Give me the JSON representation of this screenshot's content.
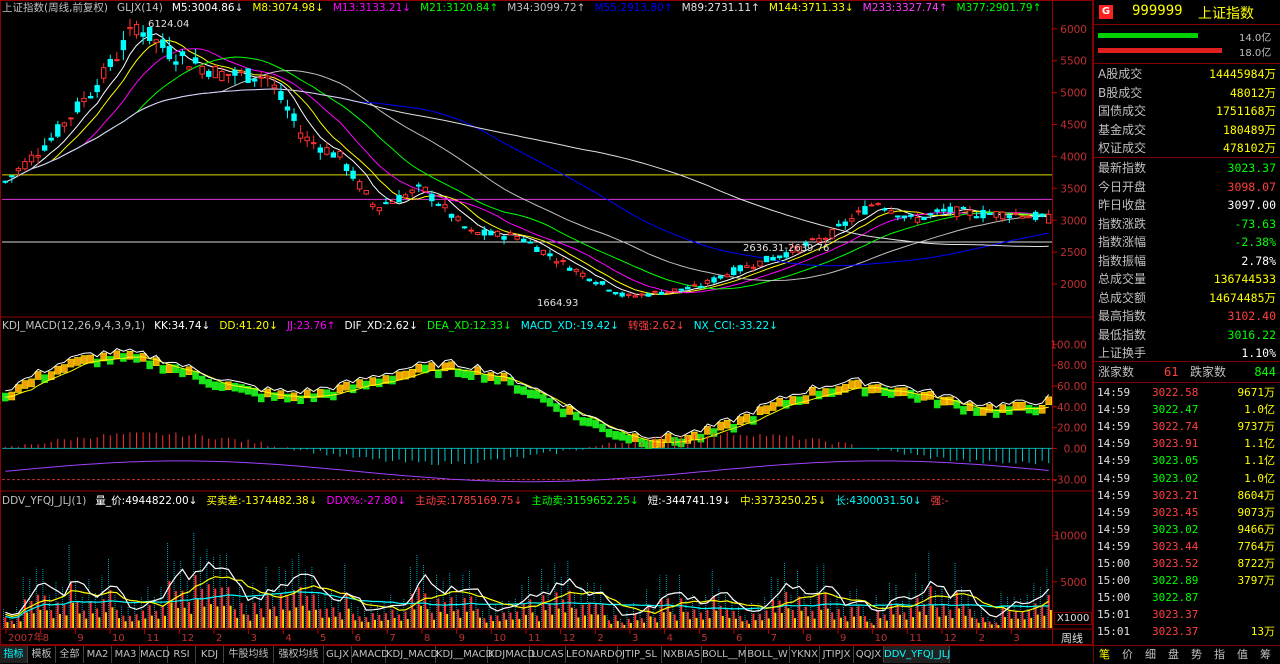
{
  "main_header": [
    {
      "text": "上证指数(周线,前复权)",
      "color": "#c0c0c0"
    },
    {
      "text": "GLJX(14)",
      "color": "#c0c0c0"
    },
    {
      "text": "M5:3004.86↓",
      "color": "#ffffff"
    },
    {
      "text": "M8:3074.98↓",
      "color": "#ffff00"
    },
    {
      "text": "M13:3133.21↓",
      "color": "#ff00ff"
    },
    {
      "text": "M21:3120.84↑",
      "color": "#00ff00"
    },
    {
      "text": "M34:3099.72↑",
      "color": "#c0c0c0"
    },
    {
      "text": "M55:2913.80↑",
      "color": "#0000ff"
    },
    {
      "text": "M89:2731.11↑",
      "color": "#e0e0e0"
    },
    {
      "text": "M144:3711.33↓",
      "color": "#ffff00"
    },
    {
      "text": "M233:3327.74↑",
      "color": "#ff40ff"
    },
    {
      "text": "M377:2901.79↑",
      "color": "#00ff00"
    }
  ],
  "kdj_header": [
    {
      "text": "KDJ_MACD(12,26,9,4,3,9,1)",
      "color": "#c0c0c0"
    },
    {
      "text": "KK:34.74↓",
      "color": "#ffffff"
    },
    {
      "text": "DD:41.20↓",
      "color": "#ffff00"
    },
    {
      "text": "JJ:23.76↑",
      "color": "#ff00ff"
    },
    {
      "text": "DIF_XD:2.62↓",
      "color": "#ffffff"
    },
    {
      "text": "DEA_XD:12.33↓",
      "color": "#00ff00"
    },
    {
      "text": "MACD_XD:-19.42↓",
      "color": "#00ffff"
    },
    {
      "text": "转强:2.62↓",
      "color": "#ff4040"
    },
    {
      "text": "NX_CCI:-33.22↓",
      "color": "#00ffff"
    }
  ],
  "ddv_header": [
    {
      "text": "DDV_YFQJ_JLJ(1)",
      "color": "#c0c0c0"
    },
    {
      "text": "量_价:4944822.00↓",
      "color": "#ffffff"
    },
    {
      "text": "买卖差:-1374482.38↓",
      "color": "#ffff00"
    },
    {
      "text": "DDX%:-27.80↓",
      "color": "#ff00ff"
    },
    {
      "text": "主动买:1785169.75↓",
      "color": "#ff4040"
    },
    {
      "text": "主动卖:3159652.25↓",
      "color": "#00ff00"
    },
    {
      "text": "短:-344741.19↓",
      "color": "#ffffff"
    },
    {
      "text": "中:3373250.25↓",
      "color": "#ffff00"
    },
    {
      "text": "长:4300031.50↓",
      "color": "#00ffff"
    },
    {
      "text": "强:-",
      "color": "#ff4040"
    }
  ],
  "chart_data": [
    {
      "type": "candlestick",
      "ylim": [
        1500,
        6200
      ],
      "y_ticks": [
        "6000",
        "5500",
        "5000",
        "4500",
        "4000",
        "3500",
        "3000",
        "2500",
        "2000"
      ],
      "annotations": {
        "high": "6124.04",
        "low": "1664.93",
        "range": "2636.31-2639.76"
      },
      "series": [
        {
          "name": "M5",
          "color": "#ffffff"
        },
        {
          "name": "M8",
          "color": "#ffff00"
        },
        {
          "name": "M13",
          "color": "#ff00ff"
        },
        {
          "name": "M21",
          "color": "#00ff00"
        },
        {
          "name": "M34",
          "color": "#c0c0c0"
        },
        {
          "name": "M55",
          "color": "#0000ff"
        },
        {
          "name": "M89",
          "color": "#e0e0e0"
        },
        {
          "name": "M144",
          "color": "#ffff00"
        },
        {
          "name": "M233",
          "color": "#ff40ff"
        },
        {
          "name": "M377",
          "color": "#00ff00"
        }
      ]
    },
    {
      "type": "line",
      "ylim": [
        -40,
        110
      ],
      "y_ticks": [
        "100.00",
        "80.00",
        "60.00",
        "40.00",
        "20.00",
        "0.00",
        "-30.00"
      ]
    },
    {
      "type": "bar",
      "ylim": [
        0,
        13000
      ],
      "y_ticks": [
        "10000",
        "5000"
      ],
      "unit": "X1000"
    }
  ],
  "x_axis_labels": [
    "2007年",
    "8",
    "9",
    "10",
    "11",
    "12",
    "2",
    "3",
    "4",
    "5",
    "6",
    "7",
    "8",
    "9",
    "10",
    "11",
    "12",
    "2",
    "3",
    "4",
    "5",
    "6",
    "7",
    "8",
    "9",
    "10",
    "11",
    "12",
    "2",
    "3"
  ],
  "x_axis_unit": "周线",
  "stock": {
    "code": "999999",
    "name": "上证指数",
    "badge": "G",
    "bar1": "14.0亿",
    "bar2": "18.0亿"
  },
  "market_stats": [
    {
      "label": "A股成交",
      "value": "14445984万",
      "color": "#ffff00"
    },
    {
      "label": "B股成交",
      "value": "48012万",
      "color": "#ffff00"
    },
    {
      "label": "国债成交",
      "value": "1751168万",
      "color": "#ffff00"
    },
    {
      "label": "基金成交",
      "value": "180489万",
      "color": "#ffff00"
    },
    {
      "label": "权证成交",
      "value": "478102万",
      "color": "#ffff00"
    }
  ],
  "index_stats": [
    {
      "label": "最新指数",
      "value": "3023.37",
      "color": "#00ff00"
    },
    {
      "label": "今日开盘",
      "value": "3098.07",
      "color": "#ff4040"
    },
    {
      "label": "昨日收盘",
      "value": "3097.00",
      "color": "#ffffff"
    },
    {
      "label": "指数涨跌",
      "value": "-73.63",
      "color": "#00ff00"
    },
    {
      "label": "指数涨幅",
      "value": "-2.38%",
      "color": "#00ff00"
    },
    {
      "label": "指数振幅",
      "value": "2.78%",
      "color": "#ffffff"
    },
    {
      "label": "总成交量",
      "value": "136744533",
      "color": "#ffff00"
    },
    {
      "label": "总成交额",
      "value": "14674485万",
      "color": "#ffff00"
    },
    {
      "label": "最高指数",
      "value": "3102.40",
      "color": "#ff4040"
    },
    {
      "label": "最低指数",
      "value": "3016.22",
      "color": "#00ff00"
    },
    {
      "label": "上证换手",
      "value": "1.10%",
      "color": "#ffffff"
    }
  ],
  "rise_fall": {
    "rise_label": "涨家数",
    "rise": "61",
    "fall_label": "跌家数",
    "fall": "844"
  },
  "ticks": [
    {
      "time": "14:59",
      "price": "3022.58",
      "vol": "9671万"
    },
    {
      "time": "14:59",
      "price": "3022.47",
      "vol": "1.0亿"
    },
    {
      "time": "14:59",
      "price": "3022.74",
      "vol": "9737万"
    },
    {
      "time": "14:59",
      "price": "3023.91",
      "vol": "1.1亿"
    },
    {
      "time": "14:59",
      "price": "3023.05",
      "vol": "1.1亿"
    },
    {
      "time": "14:59",
      "price": "3023.02",
      "vol": "1.0亿"
    },
    {
      "time": "14:59",
      "price": "3023.21",
      "vol": "8604万"
    },
    {
      "time": "14:59",
      "price": "3023.45",
      "vol": "9073万"
    },
    {
      "time": "14:59",
      "price": "3023.02",
      "vol": "9466万"
    },
    {
      "time": "14:59",
      "price": "3023.44",
      "vol": "7764万"
    },
    {
      "time": "15:00",
      "price": "3023.52",
      "vol": "8722万"
    },
    {
      "time": "15:00",
      "price": "3022.89",
      "vol": "3797万"
    },
    {
      "time": "15:00",
      "price": "3022.87",
      "vol": ""
    },
    {
      "time": "15:01",
      "price": "3023.37",
      "vol": ""
    },
    {
      "time": "15:01",
      "price": "3023.37",
      "vol": "13万"
    }
  ],
  "bottom_tabs": [
    "指标",
    "模板",
    "全部",
    "MA2",
    "MA3",
    "MACD",
    "RSI",
    "KDJ",
    "牛股均线",
    "强权均线",
    "GLJX",
    "AMACD",
    "KDJ_MACD",
    "KDJ__MACD",
    "KDJMACD",
    "LUCAS",
    "LEONARDO",
    "JTIP_SL",
    "NXBIAS",
    "BOLL__M",
    "BOLL_W",
    "YKNX",
    "JTIPJX",
    "QQJX",
    "DDV_YFQJ_JLJ"
  ],
  "right_tabs": [
    "笔",
    "价",
    "细",
    "盘",
    "势",
    "指",
    "值",
    "筹"
  ]
}
